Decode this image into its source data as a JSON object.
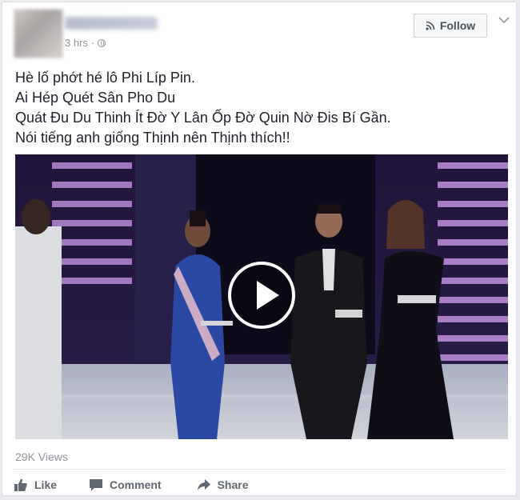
{
  "post": {
    "time": "3 hrs",
    "separator": "·",
    "follow_label": "Follow",
    "lines": [
      "Hè lố phớt hé lô Phi Líp Pin.",
      "Ai Hép Quét Sân Pho Du",
      "Quát Đu Du Thinh Ít Đờ Y Lân Ốp Đờ Quin Nờ Đis Bí Gần.",
      "Nói tiếng anh giống Thịnh nên Thịnh thích!!"
    ],
    "views": "29K Views"
  },
  "actions": {
    "like": "Like",
    "comment": "Comment",
    "share": "Share"
  },
  "icons": {
    "follow": "rss-icon",
    "privacy": "globe-icon",
    "menu": "chevron-down-icon",
    "play": "play-icon",
    "like": "thumbs-up-icon",
    "comment": "comment-icon",
    "share": "share-arrow-icon"
  },
  "colors": {
    "text": "#1d2129",
    "meta": "#90949c",
    "action": "#616770"
  }
}
